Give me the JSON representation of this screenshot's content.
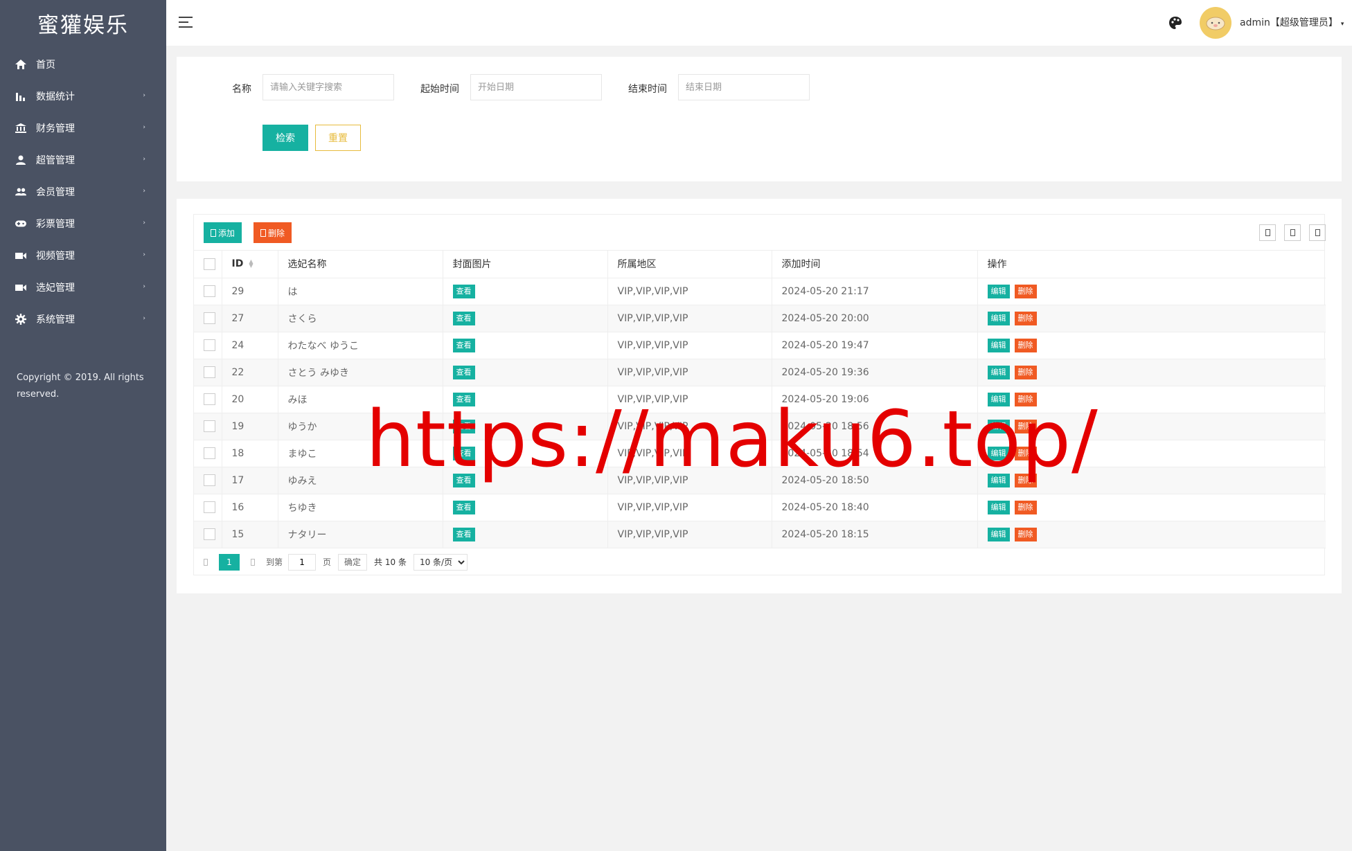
{
  "sidebar": {
    "logo": "蜜獾娱乐",
    "items": [
      {
        "label": "首页",
        "icon": "home-icon"
      },
      {
        "label": "数据统计",
        "icon": "bar-chart-icon"
      },
      {
        "label": "财务管理",
        "icon": "bank-icon"
      },
      {
        "label": "超管管理",
        "icon": "user-icon"
      },
      {
        "label": "会员管理",
        "icon": "users-icon"
      },
      {
        "label": "彩票管理",
        "icon": "gamepad-icon"
      },
      {
        "label": "视频管理",
        "icon": "video-icon"
      },
      {
        "label": "选妃管理",
        "icon": "video-icon"
      },
      {
        "label": "系统管理",
        "icon": "gear-icon"
      }
    ],
    "copyright": "Copyright © 2019. All rights reserved."
  },
  "header": {
    "user": "admin【超级管理员】"
  },
  "search": {
    "name_label": "名称",
    "name_placeholder": "请输入关键字搜索",
    "start_label": "起始时间",
    "start_placeholder": "开始日期",
    "end_label": "结束时间",
    "end_placeholder": "结束日期",
    "search_button": "检索",
    "reset_button": "重置"
  },
  "toolbar": {
    "add_label": "添加",
    "delete_label": "删除"
  },
  "table": {
    "columns": [
      "ID",
      "选妃名称",
      "封面图片",
      "所属地区",
      "添加时间",
      "操作"
    ],
    "view_label": "查看",
    "edit_label": "编辑",
    "delete_label": "删除",
    "rows": [
      {
        "id": "29",
        "name": "は",
        "region": "VIP,VIP,VIP,VIP",
        "time": "2024-05-20 21:17"
      },
      {
        "id": "27",
        "name": "さくら",
        "region": "VIP,VIP,VIP,VIP",
        "time": "2024-05-20 20:00"
      },
      {
        "id": "24",
        "name": "わたなべ ゆうこ",
        "region": "VIP,VIP,VIP,VIP",
        "time": "2024-05-20 19:47"
      },
      {
        "id": "22",
        "name": "さとう みゆき",
        "region": "VIP,VIP,VIP,VIP",
        "time": "2024-05-20 19:36"
      },
      {
        "id": "20",
        "name": "みほ",
        "region": "VIP,VIP,VIP,VIP",
        "time": "2024-05-20 19:06"
      },
      {
        "id": "19",
        "name": "ゆうか",
        "region": "VIP,VIP,VIP,VIP",
        "time": "2024-05-20 18:56"
      },
      {
        "id": "18",
        "name": "まゆこ",
        "region": "VIP,VIP,VIP,VIP",
        "time": "2024-05-20 18:54"
      },
      {
        "id": "17",
        "name": "ゆみえ",
        "region": "VIP,VIP,VIP,VIP",
        "time": "2024-05-20 18:50"
      },
      {
        "id": "16",
        "name": "ちゆき",
        "region": "VIP,VIP,VIP,VIP",
        "time": "2024-05-20 18:40"
      },
      {
        "id": "15",
        "name": "ナタリー",
        "region": "VIP,VIP,VIP,VIP",
        "time": "2024-05-20 18:15"
      }
    ]
  },
  "pagination": {
    "current_page": "1",
    "goto_label": "到第",
    "page_input": "1",
    "page_unit": "页",
    "confirm": "确定",
    "total": "共 10 条",
    "page_size": "10 条/页"
  },
  "watermark": "https://maku6.top/",
  "colors": {
    "sidebar_bg": "#4a5263",
    "primary": "#16b1a1",
    "danger": "#f05a23",
    "warning": "#e7bb3c",
    "watermark": "#e40000"
  }
}
